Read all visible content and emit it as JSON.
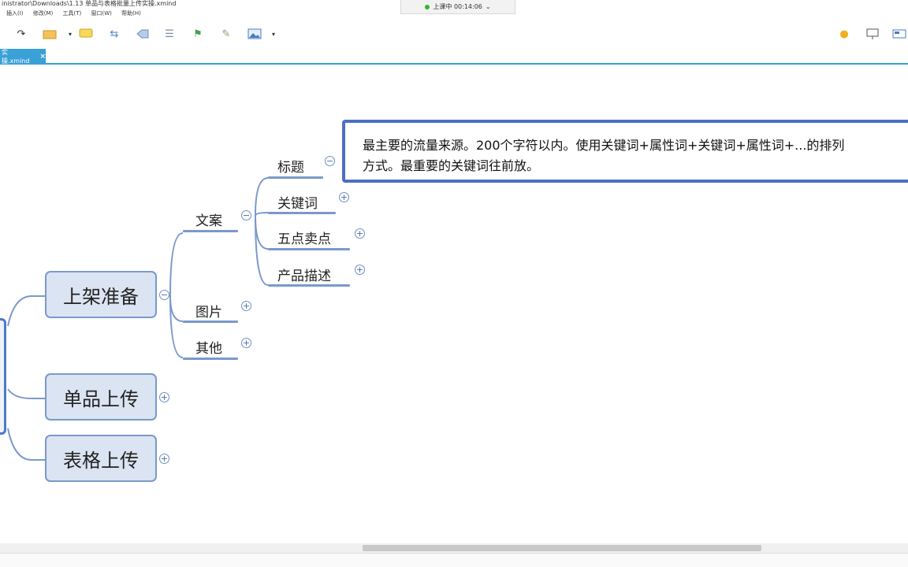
{
  "window": {
    "title": "inistrator\\Downloads\\1.13 单品与表格批量上传实操.xmind"
  },
  "menu": [
    "插入(I)",
    "修改(M)",
    "工具(T)",
    "窗口(W)",
    "帮助(H)"
  ],
  "timer": {
    "label": "上课中 00:14:06",
    "chevron": "⌄"
  },
  "toolbar_icons": [
    "redo-icon",
    "open-folder-icon",
    "comment-icon",
    "relationship-icon",
    "boundary-icon",
    "summary-icon",
    "marker-icon",
    "notes-icon",
    "image-icon",
    "idea-icon",
    "presentation-icon",
    "layout-icon"
  ],
  "tab": {
    "label": "实操.xmind",
    "close": "×"
  },
  "mindmap": {
    "main_topics": [
      "上架准备",
      "单品上传",
      "表格上传"
    ],
    "level2": [
      "文案",
      "图片",
      "其他"
    ],
    "level3": [
      "标题",
      "关键词",
      "五点卖点",
      "产品描述"
    ],
    "toggle_collapse": "−",
    "toggle_expand": "+"
  },
  "note": {
    "line1": "最主要的流量来源。200个字符以内。使用关键词+属性词+关键词+属性词+...的排列",
    "line2": "方式。最重要的关键词往前放。"
  },
  "colors": {
    "accent": "#3aa0d8",
    "node_fill": "#dbe4f2",
    "node_border": "#7a99cc",
    "note_border": "#4c6fc4"
  }
}
